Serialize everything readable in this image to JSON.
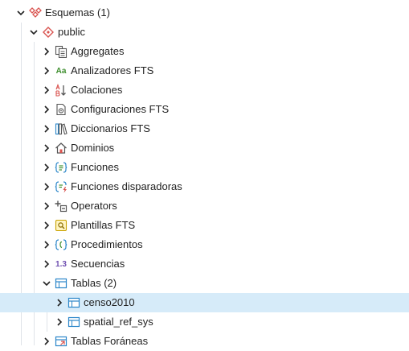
{
  "tree": {
    "root": {
      "label": "Esquemas (1)",
      "icon": "schemas-icon",
      "expanded": true
    },
    "schema": {
      "label": "public",
      "icon": "schema-icon",
      "expanded": true
    },
    "items": [
      {
        "label": "Aggregates",
        "icon": "aggregates-icon"
      },
      {
        "label": "Analizadores FTS",
        "icon": "fts-parser-icon",
        "icon_text": "Aa"
      },
      {
        "label": "Colaciones",
        "icon": "collation-icon"
      },
      {
        "label": "Configuraciones FTS",
        "icon": "fts-configuration-icon"
      },
      {
        "label": "Diccionarios FTS",
        "icon": "fts-dictionary-icon"
      },
      {
        "label": "Dominios",
        "icon": "domain-icon"
      },
      {
        "label": "Funciones",
        "icon": "function-icon"
      },
      {
        "label": "Funciones disparadoras",
        "icon": "trigger-function-icon"
      },
      {
        "label": "Operators",
        "icon": "operator-icon"
      },
      {
        "label": "Plantillas FTS",
        "icon": "fts-template-icon"
      },
      {
        "label": "Procedimientos",
        "icon": "procedure-icon"
      },
      {
        "label": "Secuencias",
        "icon": "sequence-icon",
        "icon_text": "1.3"
      }
    ],
    "tables": {
      "label": "Tablas (2)",
      "icon": "table-icon",
      "expanded": true,
      "children": [
        {
          "label": "censo2010",
          "icon": "table-icon",
          "selected": true
        },
        {
          "label": "spatial_ref_sys",
          "icon": "table-icon",
          "selected": false
        }
      ]
    },
    "foreign_tables": {
      "label": "Tablas Foráneas",
      "icon": "foreign-table-icon"
    }
  },
  "colors": {
    "selection": "#d6ebf9",
    "guide_line": "#dfe3e8",
    "schema_red": "#d9534f",
    "table_blue": "#2a86c9",
    "fts_green": "#3f8f2f",
    "sequence_purple": "#6f4fb0"
  }
}
